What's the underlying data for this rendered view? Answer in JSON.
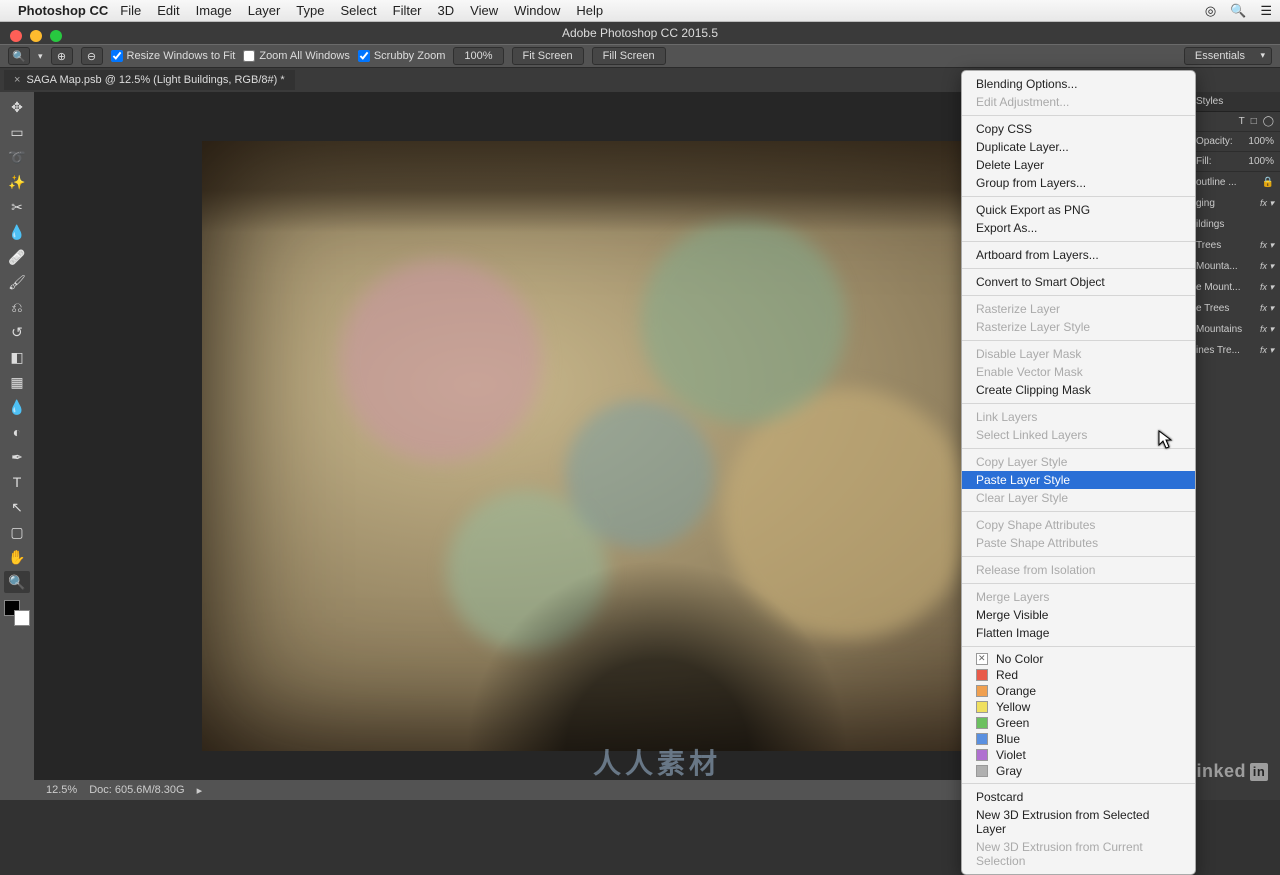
{
  "macMenu": {
    "appName": "Photoshop CC",
    "items": [
      "File",
      "Edit",
      "Image",
      "Layer",
      "Type",
      "Select",
      "Filter",
      "3D",
      "View",
      "Window",
      "Help"
    ]
  },
  "windowTitle": "Adobe Photoshop CC 2015.5",
  "optionsBar": {
    "resizeWindows": "Resize Windows to Fit",
    "zoomAll": "Zoom All Windows",
    "scrubby": "Scrubby Zoom",
    "zoom100": "100%",
    "fitScreen": "Fit Screen",
    "fillScreen": "Fill Screen",
    "workspace": "Essentials"
  },
  "tab": {
    "close": "×",
    "title": "SAGA Map.psb @ 12.5% (Light Buildings, RGB/8#) *"
  },
  "status": {
    "zoom": "12.5%",
    "doc": "Doc: 605.6M/8.30G"
  },
  "rightPanel": {
    "stylesTab": "Styles",
    "opacityLabel": "Opacity:",
    "opacityValue": "100%",
    "fillLabel": "Fill:",
    "fillValue": "100%",
    "layers": [
      {
        "name": "outline ...",
        "locked": true,
        "fx": false
      },
      {
        "name": "ging",
        "locked": false,
        "fx": true
      },
      {
        "name": "ildings",
        "locked": false,
        "fx": false
      },
      {
        "name": "Trees",
        "locked": false,
        "fx": true
      },
      {
        "name": "Mounta...",
        "locked": false,
        "fx": true
      },
      {
        "name": "e Mount...",
        "locked": false,
        "fx": true
      },
      {
        "name": "e Trees",
        "locked": false,
        "fx": true
      },
      {
        "name": "Mountains",
        "locked": false,
        "fx": true
      },
      {
        "name": "ines Tre...",
        "locked": false,
        "fx": true
      }
    ],
    "toolIcons": [
      "T",
      "□",
      "◯"
    ]
  },
  "contextMenu": {
    "groups": [
      [
        {
          "t": "Blending Options...",
          "d": false
        },
        {
          "t": "Edit Adjustment...",
          "d": true
        }
      ],
      [
        {
          "t": "Copy CSS",
          "d": false
        },
        {
          "t": "Duplicate Layer...",
          "d": false
        },
        {
          "t": "Delete Layer",
          "d": false
        },
        {
          "t": "Group from Layers...",
          "d": false
        }
      ],
      [
        {
          "t": "Quick Export as PNG",
          "d": false
        },
        {
          "t": "Export As...",
          "d": false
        }
      ],
      [
        {
          "t": "Artboard from Layers...",
          "d": false
        }
      ],
      [
        {
          "t": "Convert to Smart Object",
          "d": false
        }
      ],
      [
        {
          "t": "Rasterize Layer",
          "d": true
        },
        {
          "t": "Rasterize Layer Style",
          "d": true
        }
      ],
      [
        {
          "t": "Disable Layer Mask",
          "d": true
        },
        {
          "t": "Enable Vector Mask",
          "d": true
        },
        {
          "t": "Create Clipping Mask",
          "d": false
        }
      ],
      [
        {
          "t": "Link Layers",
          "d": true
        },
        {
          "t": "Select Linked Layers",
          "d": true
        }
      ],
      [
        {
          "t": "Copy Layer Style",
          "d": true
        },
        {
          "t": "Paste Layer Style",
          "d": false,
          "sel": true
        },
        {
          "t": "Clear Layer Style",
          "d": true
        }
      ],
      [
        {
          "t": "Copy Shape Attributes",
          "d": true
        },
        {
          "t": "Paste Shape Attributes",
          "d": true
        }
      ],
      [
        {
          "t": "Release from Isolation",
          "d": true
        }
      ],
      [
        {
          "t": "Merge Layers",
          "d": true
        },
        {
          "t": "Merge Visible",
          "d": false
        },
        {
          "t": "Flatten Image",
          "d": false
        }
      ]
    ],
    "colors": [
      {
        "label": "No Color",
        "c": "none"
      },
      {
        "label": "Red",
        "c": "#e85b4a"
      },
      {
        "label": "Orange",
        "c": "#f0a050"
      },
      {
        "label": "Yellow",
        "c": "#f0e060"
      },
      {
        "label": "Green",
        "c": "#6cc060"
      },
      {
        "label": "Blue",
        "c": "#5a90e0"
      },
      {
        "label": "Violet",
        "c": "#b070d0"
      },
      {
        "label": "Gray",
        "c": "#b0b0b0"
      }
    ],
    "postGroup": [
      {
        "t": "Postcard",
        "d": false
      },
      {
        "t": "New 3D Extrusion from Selected Layer",
        "d": false
      },
      {
        "t": "New 3D Extrusion from Current Selection",
        "d": true
      }
    ]
  },
  "watermark": "人人素材",
  "linkedin": {
    "text": "Linked",
    "box": "in"
  }
}
